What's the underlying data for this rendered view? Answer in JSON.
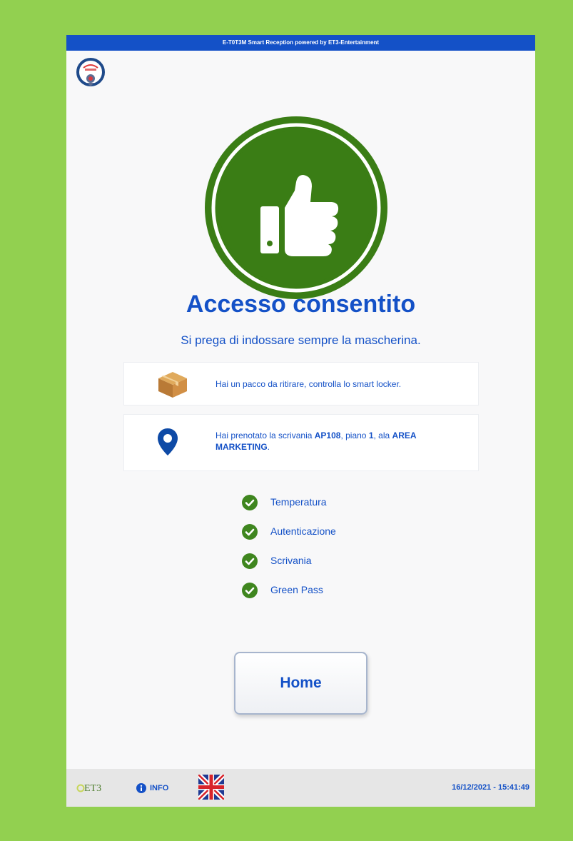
{
  "header": {
    "title": "E-T0T3M Smart Reception powered by ET3-Entertainment"
  },
  "main": {
    "title": "Accesso consentito",
    "subtitle": "Si prega di indossare sempre la mascherina."
  },
  "package_card": {
    "text": "Hai un pacco da ritirare, controlla lo smart locker."
  },
  "desk_card": {
    "prefix": "Hai prenotato la scrivania ",
    "desk": "AP108",
    "mid1": ", piano ",
    "floor": "1",
    "mid2": ", ala ",
    "area": "AREA MARKETING",
    "suffix": "."
  },
  "checks": [
    {
      "label": "Temperatura"
    },
    {
      "label": "Autenticazione"
    },
    {
      "label": "Scrivania"
    },
    {
      "label": "Green Pass"
    }
  ],
  "home_button": {
    "label": "Home"
  },
  "footer": {
    "logo_text": "ET3",
    "info_label": "INFO",
    "language_flag": "uk-flag-icon",
    "datetime": "16/12/2021 - 15:41:49"
  },
  "colors": {
    "background": "#92d050",
    "accent": "#1451c7",
    "success": "#3a7d15",
    "check": "#3f861f",
    "package": "#c8893b"
  }
}
